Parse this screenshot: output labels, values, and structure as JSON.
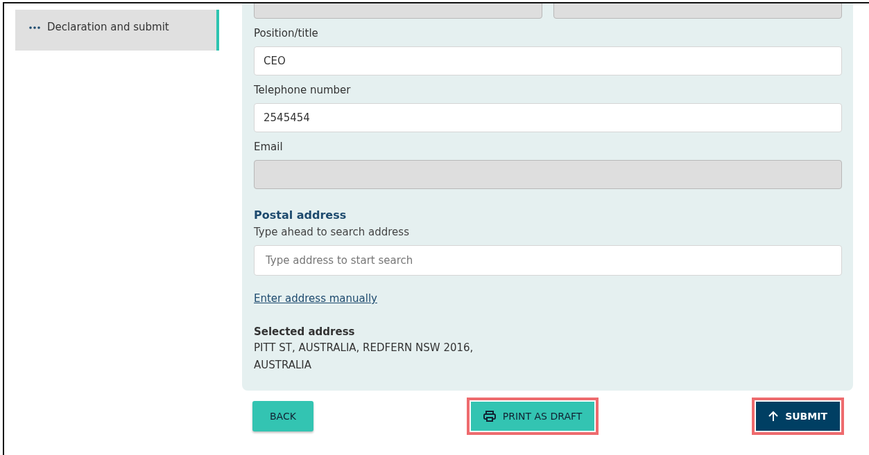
{
  "sidebar": {
    "items": [
      {
        "label": "Declaration and submit",
        "selected": true
      }
    ]
  },
  "form": {
    "top_fields": [
      {
        "disabled": true
      },
      {
        "disabled": true
      }
    ],
    "fields": [
      {
        "label": "Position/title",
        "value": "CEO",
        "disabled": false
      },
      {
        "label": "Telephone number",
        "value": "2545454",
        "disabled": false
      },
      {
        "label": "Email",
        "disabled": true
      }
    ],
    "postal_address": {
      "heading": "Postal address",
      "hint": "Type ahead to search address",
      "placeholder": "Type address to start search",
      "manual_link": "Enter address manually",
      "selected_label": "Selected address",
      "selected_lines": [
        "PITT ST, AUSTRALIA, REDFERN NSW 2016,",
        "AUSTRALIA"
      ]
    }
  },
  "buttons": [
    {
      "kind": "back",
      "label": "BACK",
      "highlighted": false
    },
    {
      "kind": "print",
      "label": "PRINT AS DRAFT",
      "highlighted": true
    },
    {
      "kind": "submit",
      "label": "SUBMIT",
      "highlighted": true
    }
  ]
}
